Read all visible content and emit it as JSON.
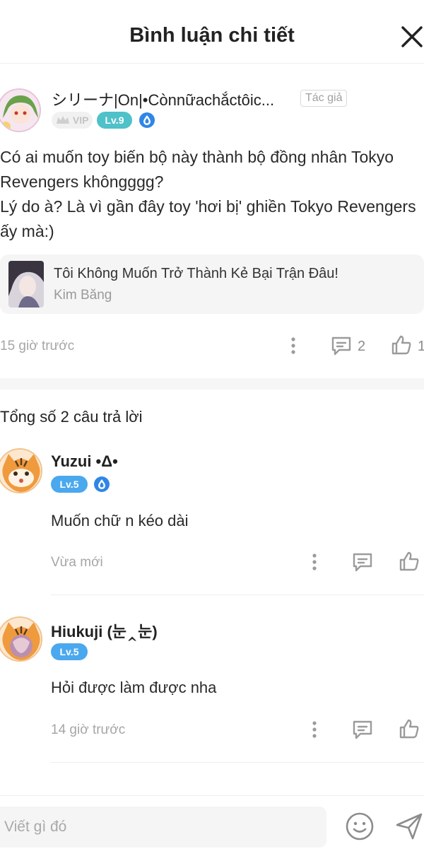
{
  "header": {
    "title": "Bình luận chi tiết"
  },
  "post": {
    "author_name": "シリーナ|On|•Cònnữachắctôic...",
    "author_tag": "Tác giả",
    "vip_label": "VIP",
    "level_label": "Lv.9",
    "body_lines": [
      "Có ai muốn toy biến bộ này thành bộ đồng nhân Tokyo",
      "Revengers khôngggg?",
      "Lý do à? Là vì gần đây toy 'hơi bị' ghiền Tokyo Revengers",
      "ấy mà:)"
    ],
    "book": {
      "title": "Tôi Không Muốn Trở Thành Kẻ Bại Trận Đâu!",
      "author": "Kim Băng"
    },
    "time": "15 giờ trước",
    "comment_count": "2",
    "like_count": "1"
  },
  "replies_total": "Tổng số 2 câu trả lời",
  "replies": [
    {
      "name": "Yuzui •Δ•",
      "level": "Lv.5",
      "text": "Muốn chữ n kéo dài",
      "time": "Vừa mới"
    },
    {
      "name": "Hiukuji (눈‸눈)",
      "level": "Lv.5",
      "text": "Hỏi được làm được nha",
      "time": "14 giờ trước"
    }
  ],
  "composer": {
    "placeholder": "Viết gì đó"
  },
  "colors": {
    "level_badge_author": "#4fc1c9",
    "level_badge_reply": "#4aa8ee",
    "icon_gray": "#9b9b9b"
  },
  "icons": [
    "close-icon",
    "more-icon",
    "comment-icon",
    "like-icon",
    "water-drop-icon",
    "crown-icon",
    "emoji-icon",
    "send-icon"
  ]
}
